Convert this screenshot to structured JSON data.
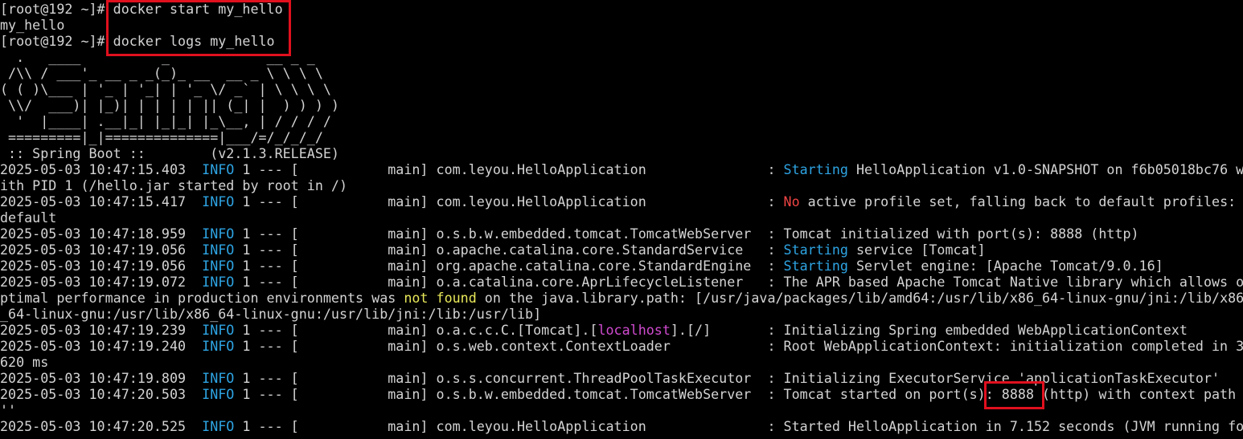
{
  "terminal": {
    "lines": [
      {
        "segments": [
          {
            "text": "[root@192 ~]# ",
            "c": "fg"
          },
          {
            "text": "docker start my_hello",
            "c": "fg"
          }
        ]
      },
      {
        "segments": [
          {
            "text": "my_hello",
            "c": "fg"
          }
        ]
      },
      {
        "segments": [
          {
            "text": "[root@192 ~]# ",
            "c": "fg"
          },
          {
            "text": "docker logs my_hello",
            "c": "fg"
          }
        ]
      },
      {
        "segments": [
          {
            "text": "  .   ____          _            __ _ _",
            "c": "fg"
          }
        ]
      },
      {
        "segments": [
          {
            "text": " /\\\\ / ___'_ __ _ _(_)_ __  __ _ \\ \\ \\ \\",
            "c": "fg"
          }
        ]
      },
      {
        "segments": [
          {
            "text": "( ( )\\___ | '_ | '_| | '_ \\/ _` | \\ \\ \\ \\",
            "c": "fg"
          }
        ]
      },
      {
        "segments": [
          {
            "text": " \\\\/  ___)| |_)| | | | | || (_| |  ) ) ) )",
            "c": "fg"
          }
        ]
      },
      {
        "segments": [
          {
            "text": "  '  |____| .__|_| |_|_| |_\\__, | / / / /",
            "c": "fg"
          }
        ]
      },
      {
        "segments": [
          {
            "text": " =========|_|==============|___/=/_/_/_/",
            "c": "fg"
          }
        ]
      },
      {
        "segments": [
          {
            "text": " :: Spring Boot ::        (v2.1.3.RELEASE)",
            "c": "fg"
          }
        ]
      },
      {
        "segments": [
          {
            "text": "2025-05-03 10:47:15.403  ",
            "c": "fg"
          },
          {
            "text": "INFO",
            "c": "blue"
          },
          {
            "text": " 1 --- [           main] com.leyou.HelloApplication               : ",
            "c": "fg"
          },
          {
            "text": "Starting",
            "c": "blue"
          },
          {
            "text": " HelloApplication v1.0-SNAPSHOT on f6b05018bc76 w",
            "c": "fg"
          }
        ]
      },
      {
        "segments": [
          {
            "text": "ith PID 1 (/hello.jar started by root in /)",
            "c": "fg"
          }
        ]
      },
      {
        "segments": [
          {
            "text": "2025-05-03 10:47:15.417  ",
            "c": "fg"
          },
          {
            "text": "INFO",
            "c": "blue"
          },
          {
            "text": " 1 --- [           main] com.leyou.HelloApplication               : ",
            "c": "fg"
          },
          {
            "text": "No",
            "c": "red"
          },
          {
            "text": " active profile set, falling back to default profiles:",
            "c": "fg"
          }
        ]
      },
      {
        "segments": [
          {
            "text": "default",
            "c": "fg"
          }
        ]
      },
      {
        "segments": [
          {
            "text": "2025-05-03 10:47:18.959  ",
            "c": "fg"
          },
          {
            "text": "INFO",
            "c": "blue"
          },
          {
            "text": " 1 --- [           main] o.s.b.w.embedded.tomcat.TomcatWebServer  : Tomcat initialized with port(s): 8888 (http)",
            "c": "fg"
          }
        ]
      },
      {
        "segments": [
          {
            "text": "2025-05-03 10:47:19.056  ",
            "c": "fg"
          },
          {
            "text": "INFO",
            "c": "blue"
          },
          {
            "text": " 1 --- [           main] o.apache.catalina.core.StandardService   : ",
            "c": "fg"
          },
          {
            "text": "Starting",
            "c": "blue"
          },
          {
            "text": " service [Tomcat]",
            "c": "fg"
          }
        ]
      },
      {
        "segments": [
          {
            "text": "2025-05-03 10:47:19.056  ",
            "c": "fg"
          },
          {
            "text": "INFO",
            "c": "blue"
          },
          {
            "text": " 1 --- [           main] org.apache.catalina.core.StandardEngine  : ",
            "c": "fg"
          },
          {
            "text": "Starting",
            "c": "blue"
          },
          {
            "text": " Servlet engine: [Apache Tomcat/9.0.16]",
            "c": "fg"
          }
        ]
      },
      {
        "segments": [
          {
            "text": "2025-05-03 10:47:19.072  ",
            "c": "fg"
          },
          {
            "text": "INFO",
            "c": "blue"
          },
          {
            "text": " 1 --- [           main] o.a.catalina.core.AprLifecycleListener   : The APR based Apache Tomcat Native library which allows o",
            "c": "fg"
          }
        ]
      },
      {
        "segments": [
          {
            "text": "ptimal performance in production environments was ",
            "c": "fg"
          },
          {
            "text": "not found",
            "c": "yellow"
          },
          {
            "text": " on the java.library.path: [/usr/java/packages/lib/amd64:/usr/lib/x86_64-linux-gnu/jni:/lib/x86",
            "c": "fg"
          }
        ]
      },
      {
        "segments": [
          {
            "text": "_64-linux-gnu:/usr/lib/x86_64-linux-gnu:/usr/lib/jni:/lib:/usr/lib]",
            "c": "fg"
          }
        ]
      },
      {
        "segments": [
          {
            "text": "2025-05-03 10:47:19.239  ",
            "c": "fg"
          },
          {
            "text": "INFO",
            "c": "blue"
          },
          {
            "text": " 1 --- [           main] o.a.c.c.C.[Tomcat].[",
            "c": "fg"
          },
          {
            "text": "localhost",
            "c": "magenta"
          },
          {
            "text": "].[/]       : Initializing Spring embedded WebApplicationContext",
            "c": "fg"
          }
        ]
      },
      {
        "segments": [
          {
            "text": "2025-05-03 10:47:19.240  ",
            "c": "fg"
          },
          {
            "text": "INFO",
            "c": "blue"
          },
          {
            "text": " 1 --- [           main] o.s.web.context.ContextLoader            : Root WebApplicationContext: initialization completed in 3",
            "c": "fg"
          }
        ]
      },
      {
        "segments": [
          {
            "text": "620 ms",
            "c": "fg"
          }
        ]
      },
      {
        "segments": [
          {
            "text": "2025-05-03 10:47:19.809  ",
            "c": "fg"
          },
          {
            "text": "INFO",
            "c": "blue"
          },
          {
            "text": " 1 --- [           main] o.s.s.concurrent.ThreadPoolTaskExecutor  : Initializing ExecutorService 'applicationTaskExecutor'",
            "c": "fg"
          }
        ]
      },
      {
        "segments": [
          {
            "text": "2025-05-03 10:47:20.503  ",
            "c": "fg"
          },
          {
            "text": "INFO",
            "c": "blue"
          },
          {
            "text": " 1 --- [           main] o.s.b.w.embedded.tomcat.TomcatWebServer  : Tomcat started on port(s): 8888 (http) with context path",
            "c": "fg"
          }
        ]
      },
      {
        "segments": [
          {
            "text": "''",
            "c": "fg"
          }
        ]
      },
      {
        "segments": [
          {
            "text": "2025-05-03 10:47:20.525  ",
            "c": "fg"
          },
          {
            "text": "INFO",
            "c": "blue"
          },
          {
            "text": " 1 --- [           main] com.leyou.HelloApplication               : Started HelloApplication in 7.152 seconds (JVM running fo",
            "c": "fg"
          }
        ]
      }
    ]
  },
  "colors": {
    "background": "#000000",
    "foreground": "#d4d4d4",
    "blue": "#2ea4e3",
    "red": "#ef4444",
    "yellow": "#e8e85a",
    "magenta": "#d04bd0",
    "highlight": "#e0101e"
  }
}
